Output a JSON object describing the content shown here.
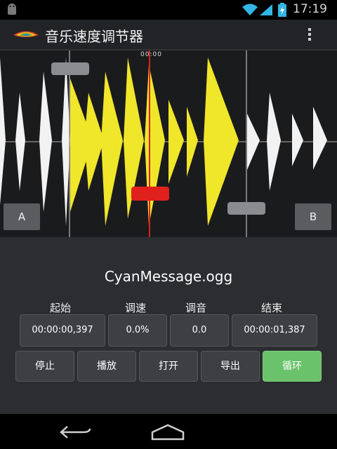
{
  "status_bar": {
    "time": "17:19",
    "icons": [
      "android-icon",
      "wifi-icon",
      "signal-icon",
      "battery-icon"
    ]
  },
  "app_bar": {
    "title": "音乐速度调节器",
    "icons": [
      "app-logo-icon",
      "overflow-menu-icon"
    ]
  },
  "waveform": {
    "time_marker": "00:00",
    "marker_a_label": "A",
    "marker_b_label": "B",
    "colors": {
      "selected": "#f0e62a",
      "unselected": "#f2f2f2",
      "playhead": "#e0201c"
    }
  },
  "file": {
    "name": "CyanMessage.ogg"
  },
  "controls": {
    "start_label": "起始",
    "speed_label": "调速",
    "pitch_label": "调音",
    "end_label": "结束",
    "start_value": "00:00:00,397",
    "speed_value": "0.0%",
    "pitch_value": "0.0",
    "end_value": "00:00:01,387"
  },
  "buttons": {
    "stop": "停止",
    "play": "播放",
    "open": "打开",
    "export": "导出",
    "loop": "循环",
    "loop_color": "#6ac26a"
  },
  "nav_bar": {
    "icons": [
      "back-icon",
      "home-icon"
    ]
  }
}
